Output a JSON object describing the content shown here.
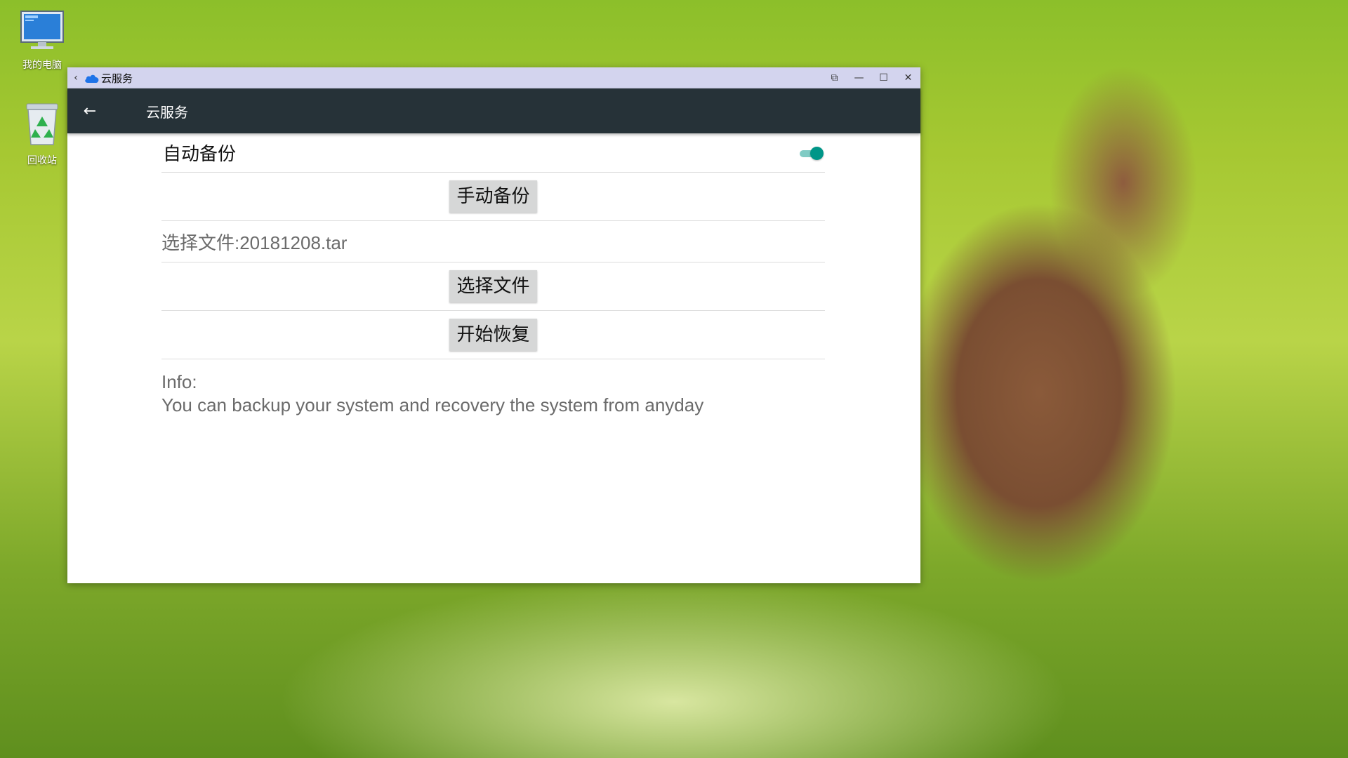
{
  "desktop": {
    "icons": [
      {
        "label": "我的电脑",
        "icon": "computer-icon"
      },
      {
        "label": "回收站",
        "icon": "recycle-bin-icon"
      }
    ]
  },
  "window": {
    "titlebar": {
      "back_icon": "‹",
      "cloud_icon": "cloud-icon",
      "title": "云服务",
      "controls": {
        "pin": "⧉",
        "minimize": "—",
        "maximize": "☐",
        "close": "✕"
      }
    },
    "appbar": {
      "back_icon": "←",
      "title": "云服务"
    },
    "settings": {
      "auto_backup_label": "自动备份",
      "auto_backup_on": true,
      "manual_backup_button": "手动备份",
      "selected_file_text": "选择文件:20181208.tar",
      "select_file_button": "选择文件",
      "start_restore_button": "开始恢复",
      "info_title": "Info:",
      "info_text": "You can backup your system and recovery the system from anyday"
    }
  },
  "colors": {
    "appbar": "#263238",
    "titlebar": "#d3d4ee",
    "toggle_accent": "#009688"
  }
}
